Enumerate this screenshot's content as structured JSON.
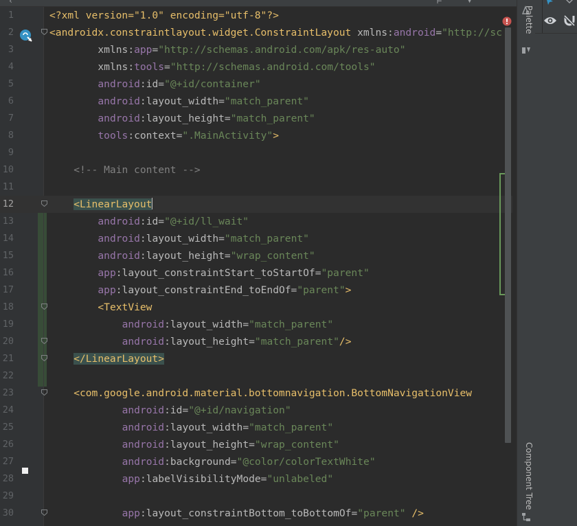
{
  "editor": {
    "lines": [
      {
        "n": "1",
        "indent": 0,
        "tokens": [
          {
            "c": "t-pi",
            "t": "<?xml version=\"1.0\" encoding=\"utf-8\"?>"
          }
        ]
      },
      {
        "n": "2",
        "indent": 0,
        "tokens": [
          {
            "c": "t-tag",
            "t": "<androidx.constraintlayout.widget.ConstraintLayout "
          },
          {
            "c": "t-attr",
            "t": "xmlns:"
          },
          {
            "c": "t-ns",
            "t": "android"
          },
          {
            "c": "t-attr",
            "t": "="
          },
          {
            "c": "t-val",
            "t": "\"http://sc"
          }
        ]
      },
      {
        "n": "3",
        "indent": 8,
        "tokens": [
          {
            "c": "t-attr",
            "t": "xmlns:"
          },
          {
            "c": "t-ns",
            "t": "app"
          },
          {
            "c": "t-attr",
            "t": "="
          },
          {
            "c": "t-val",
            "t": "\"http://schemas.android.com/apk/res-auto\""
          }
        ]
      },
      {
        "n": "4",
        "indent": 8,
        "tokens": [
          {
            "c": "t-attr",
            "t": "xmlns:"
          },
          {
            "c": "t-ns",
            "t": "tools"
          },
          {
            "c": "t-attr",
            "t": "="
          },
          {
            "c": "t-val",
            "t": "\"http://schemas.android.com/tools\""
          }
        ]
      },
      {
        "n": "5",
        "indent": 8,
        "tokens": [
          {
            "c": "t-ns",
            "t": "android"
          },
          {
            "c": "t-attr",
            "t": ":id="
          },
          {
            "c": "t-val",
            "t": "\"@+id/container\""
          }
        ]
      },
      {
        "n": "6",
        "indent": 8,
        "tokens": [
          {
            "c": "t-ns",
            "t": "android"
          },
          {
            "c": "t-attr",
            "t": ":layout_width="
          },
          {
            "c": "t-val",
            "t": "\"match_parent\""
          }
        ]
      },
      {
        "n": "7",
        "indent": 8,
        "tokens": [
          {
            "c": "t-ns",
            "t": "android"
          },
          {
            "c": "t-attr",
            "t": ":layout_height="
          },
          {
            "c": "t-val",
            "t": "\"match_parent\""
          }
        ]
      },
      {
        "n": "8",
        "indent": 8,
        "tokens": [
          {
            "c": "t-ns",
            "t": "tools"
          },
          {
            "c": "t-attr",
            "t": ":context="
          },
          {
            "c": "t-val",
            "t": "\".MainActivity\""
          },
          {
            "c": "t-tag",
            "t": ">"
          }
        ]
      },
      {
        "n": "9",
        "indent": 0,
        "tokens": []
      },
      {
        "n": "10",
        "indent": 4,
        "tokens": [
          {
            "c": "t-cmt",
            "t": "<!-- Main content -->"
          }
        ]
      },
      {
        "n": "11",
        "indent": 0,
        "tokens": []
      },
      {
        "n": "12",
        "indent": 4,
        "current": true,
        "tokens": [
          {
            "c": "t-tag pair",
            "t": "<"
          },
          {
            "c": "t-tag pair",
            "t": "LinearLayout"
          },
          {
            "c": "caret",
            "t": ""
          }
        ]
      },
      {
        "n": "13",
        "indent": 8,
        "tokens": [
          {
            "c": "t-ns",
            "t": "android"
          },
          {
            "c": "t-attr",
            "t": ":id="
          },
          {
            "c": "t-val",
            "t": "\"@+id/ll_wait\""
          }
        ]
      },
      {
        "n": "14",
        "indent": 8,
        "tokens": [
          {
            "c": "t-ns",
            "t": "android"
          },
          {
            "c": "t-attr",
            "t": ":layout_width="
          },
          {
            "c": "t-val",
            "t": "\"match_parent\""
          }
        ]
      },
      {
        "n": "15",
        "indent": 8,
        "tokens": [
          {
            "c": "t-ns",
            "t": "android"
          },
          {
            "c": "t-attr",
            "t": ":layout_height="
          },
          {
            "c": "t-val",
            "t": "\"wrap_content\""
          }
        ]
      },
      {
        "n": "16",
        "indent": 8,
        "tokens": [
          {
            "c": "t-ns",
            "t": "app"
          },
          {
            "c": "t-attr",
            "t": ":layout_constraintStart_toStartOf="
          },
          {
            "c": "t-val",
            "t": "\"parent\""
          }
        ]
      },
      {
        "n": "17",
        "indent": 8,
        "tokens": [
          {
            "c": "t-ns",
            "t": "app"
          },
          {
            "c": "t-attr",
            "t": ":layout_constraintEnd_toEndOf="
          },
          {
            "c": "t-val",
            "t": "\"parent\""
          },
          {
            "c": "t-tag",
            "t": ">"
          }
        ]
      },
      {
        "n": "18",
        "indent": 8,
        "tokens": [
          {
            "c": "t-tag",
            "t": "<TextView"
          }
        ]
      },
      {
        "n": "19",
        "indent": 12,
        "tokens": [
          {
            "c": "t-ns",
            "t": "android"
          },
          {
            "c": "t-attr",
            "t": ":layout_width="
          },
          {
            "c": "t-val",
            "t": "\"match_parent\""
          }
        ]
      },
      {
        "n": "20",
        "indent": 12,
        "tokens": [
          {
            "c": "t-ns",
            "t": "android"
          },
          {
            "c": "t-attr",
            "t": ":layout_height="
          },
          {
            "c": "t-val",
            "t": "\"match_parent\""
          },
          {
            "c": "t-tag",
            "t": "/>"
          }
        ]
      },
      {
        "n": "21",
        "indent": 4,
        "tokens": [
          {
            "c": "t-tag pair",
            "t": "</LinearLayout>"
          }
        ]
      },
      {
        "n": "22",
        "indent": 0,
        "tokens": []
      },
      {
        "n": "23",
        "indent": 4,
        "tokens": [
          {
            "c": "t-tag",
            "t": "<com.google.android.material.bottomnavigation.BottomNavigationView"
          }
        ]
      },
      {
        "n": "24",
        "indent": 12,
        "tokens": [
          {
            "c": "t-ns",
            "t": "android"
          },
          {
            "c": "t-attr",
            "t": ":id="
          },
          {
            "c": "t-val",
            "t": "\"@+id/navigation\""
          }
        ]
      },
      {
        "n": "25",
        "indent": 12,
        "tokens": [
          {
            "c": "t-ns",
            "t": "android"
          },
          {
            "c": "t-attr",
            "t": ":layout_width="
          },
          {
            "c": "t-val",
            "t": "\"match_parent\""
          }
        ]
      },
      {
        "n": "26",
        "indent": 12,
        "tokens": [
          {
            "c": "t-ns",
            "t": "android"
          },
          {
            "c": "t-attr",
            "t": ":layout_height="
          },
          {
            "c": "t-val",
            "t": "\"wrap_content\""
          }
        ]
      },
      {
        "n": "27",
        "indent": 12,
        "tokens": [
          {
            "c": "t-ns",
            "t": "android"
          },
          {
            "c": "t-attr",
            "t": ":background="
          },
          {
            "c": "t-val",
            "t": "\"@color/colorTextWhite\""
          }
        ]
      },
      {
        "n": "28",
        "indent": 12,
        "tokens": [
          {
            "c": "t-ns",
            "t": "app"
          },
          {
            "c": "t-attr",
            "t": ":labelVisibilityMode="
          },
          {
            "c": "t-val",
            "t": "\"unlabeled\""
          }
        ]
      },
      {
        "n": "29",
        "indent": 0,
        "tokens": []
      },
      {
        "n": "30",
        "indent": 12,
        "tokens": [
          {
            "c": "t-ns",
            "t": "app"
          },
          {
            "c": "t-attr",
            "t": ":layout_constraintBottom_toBottomOf="
          },
          {
            "c": "t-val",
            "t": "\"parent\""
          },
          {
            "c": "t-tag",
            "t": " />"
          }
        ]
      }
    ],
    "fold_lines": [
      "2",
      "12",
      "18",
      "20",
      "21",
      "23",
      "30"
    ]
  },
  "right_panel": {
    "palette_label": "Palette",
    "component_tree_label": "Component Tree"
  },
  "icons": {
    "gutter_run": "activity-gutter-icon",
    "error": "error-indicator-icon",
    "eye": "eye-icon",
    "magnet": "magnet-icon"
  },
  "colors": {
    "editor_bg": "#2b2b2b",
    "tag": "#e8bf6a",
    "namespace": "#9876aa",
    "value": "#6a8759",
    "comment": "#808080",
    "error": "#c75450"
  }
}
